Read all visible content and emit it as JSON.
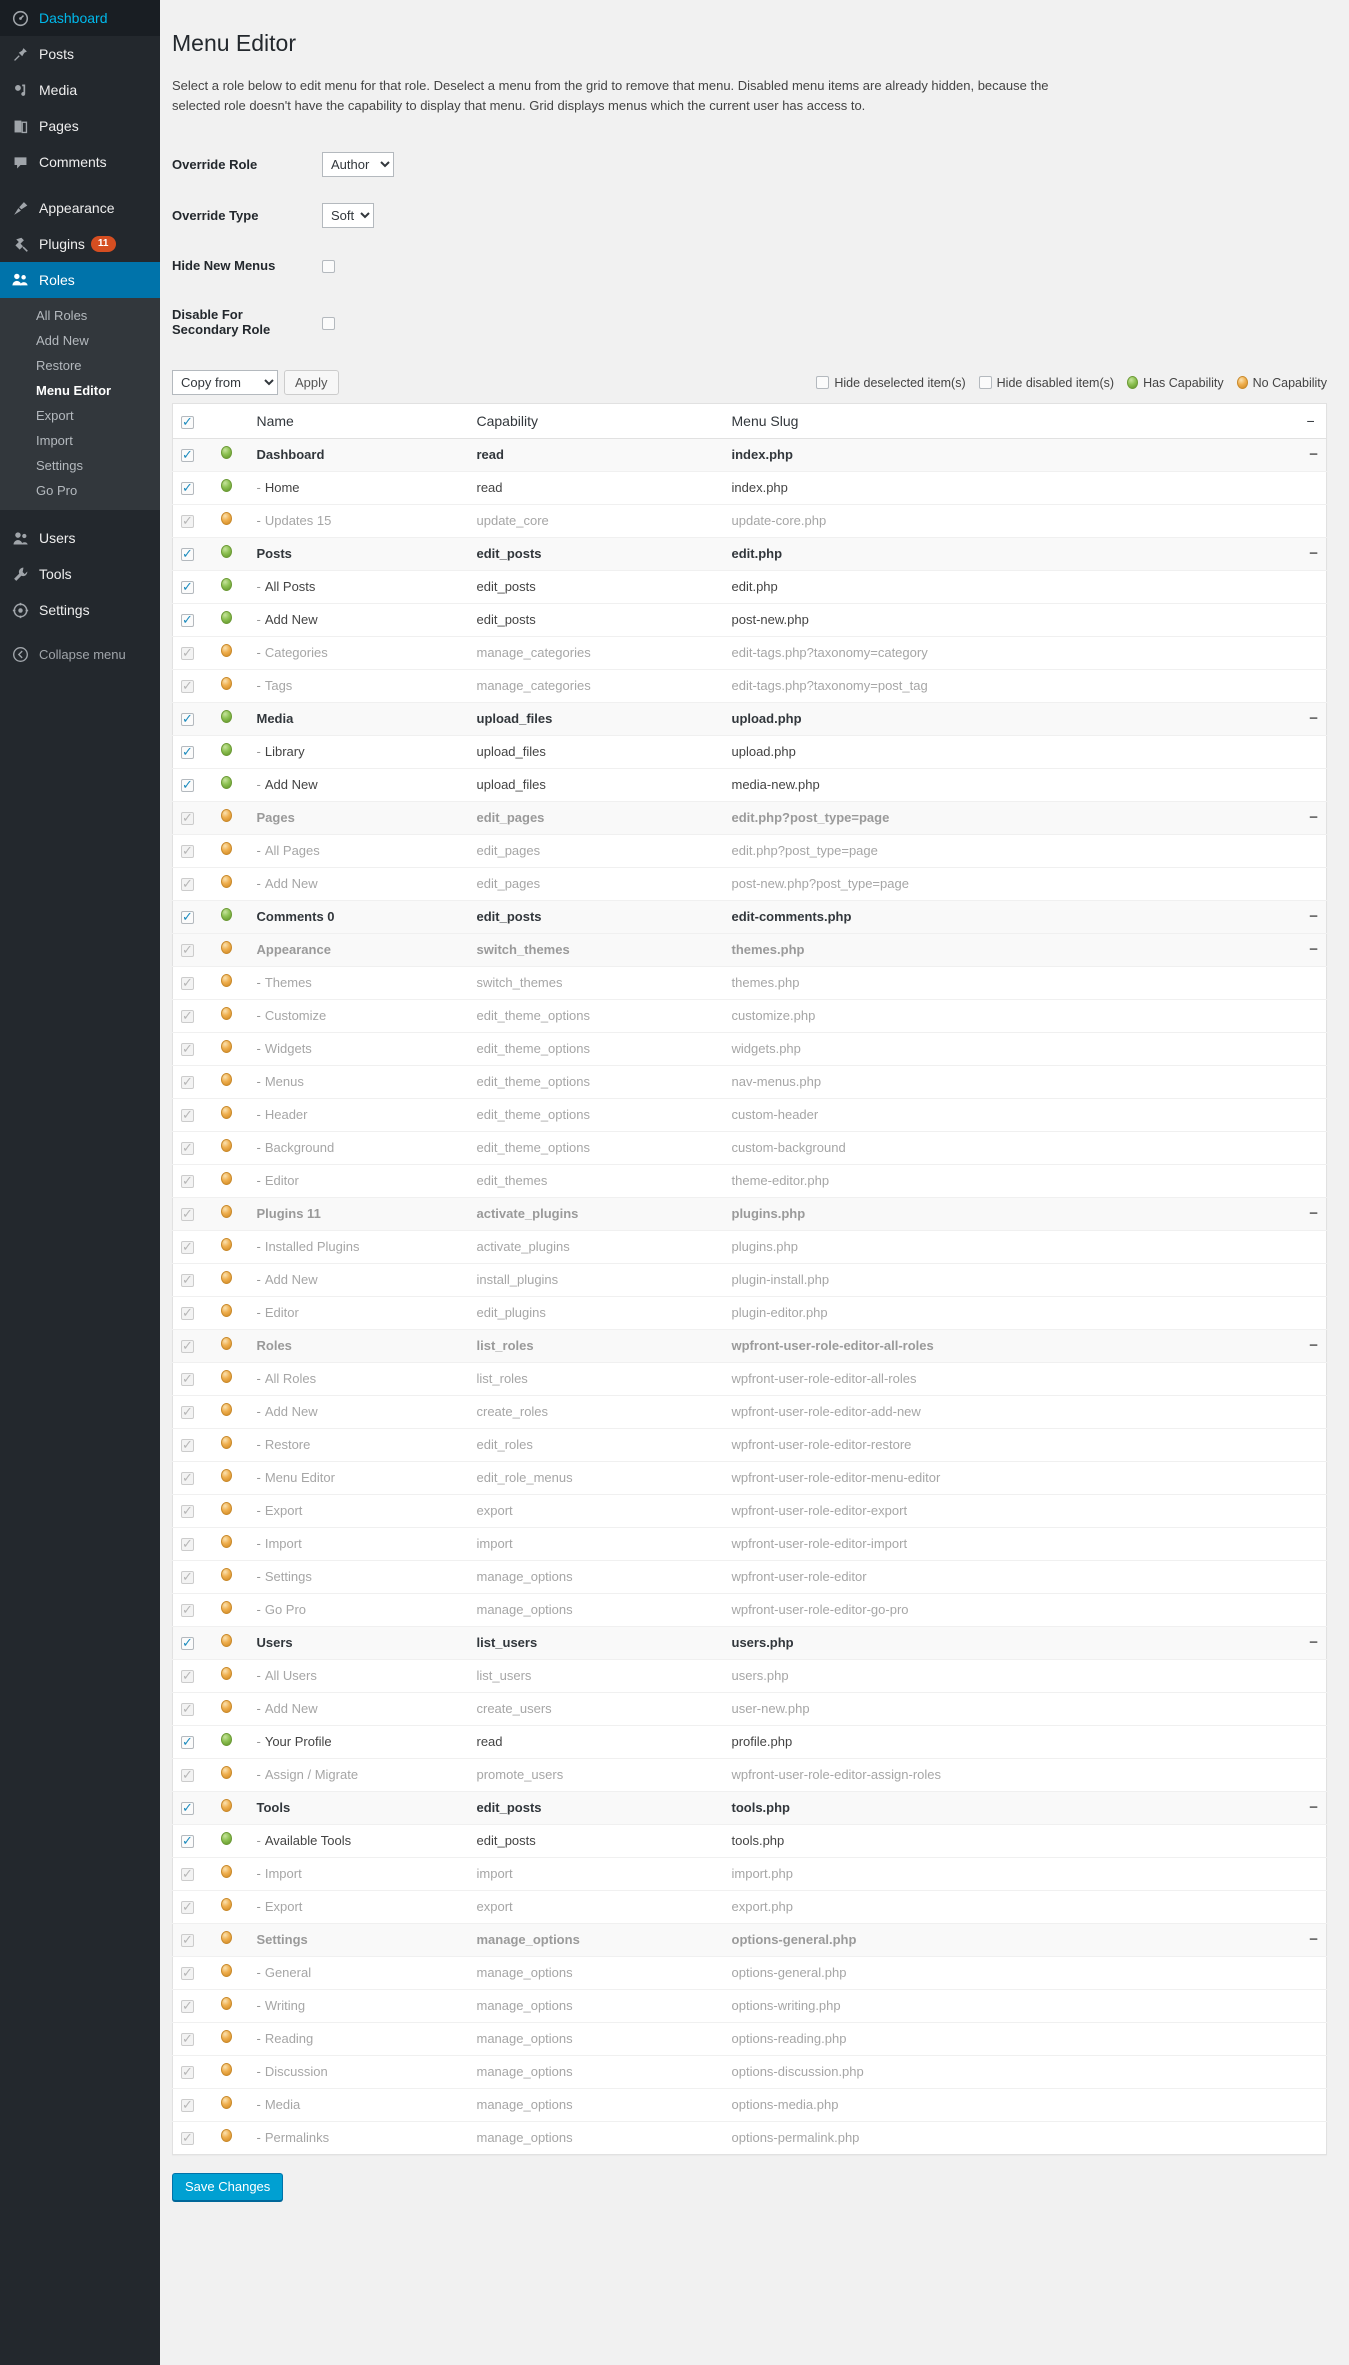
{
  "sidebar": {
    "top_items": [
      {
        "label": "Dashboard",
        "icon": "dashboard-icon",
        "current": false,
        "badge": null
      },
      {
        "label": "Posts",
        "icon": "pin-icon",
        "current": false,
        "badge": null
      },
      {
        "label": "Media",
        "icon": "media-icon",
        "current": false,
        "badge": null
      },
      {
        "label": "Pages",
        "icon": "pages-icon",
        "current": false,
        "badge": null
      },
      {
        "label": "Comments",
        "icon": "comments-icon",
        "current": false,
        "badge": null
      }
    ],
    "group2": [
      {
        "label": "Appearance",
        "icon": "appearance-icon",
        "current": false,
        "badge": null
      },
      {
        "label": "Plugins",
        "icon": "plugins-icon",
        "current": false,
        "badge": "11"
      },
      {
        "label": "Roles",
        "icon": "roles-icon",
        "current": true,
        "badge": null
      }
    ],
    "roles_submenu": [
      {
        "label": "All Roles",
        "current": false
      },
      {
        "label": "Add New",
        "current": false
      },
      {
        "label": "Restore",
        "current": false
      },
      {
        "label": "Menu Editor",
        "current": true
      },
      {
        "label": "Export",
        "current": false
      },
      {
        "label": "Import",
        "current": false
      },
      {
        "label": "Settings",
        "current": false
      },
      {
        "label": "Go Pro",
        "current": false
      }
    ],
    "group3": [
      {
        "label": "Users",
        "icon": "users-icon",
        "current": false,
        "badge": null
      },
      {
        "label": "Tools",
        "icon": "tools-icon",
        "current": false,
        "badge": null
      },
      {
        "label": "Settings",
        "icon": "settings-gear-icon",
        "current": false,
        "badge": null
      }
    ],
    "collapse": {
      "label": "Collapse menu",
      "icon": "collapse-arrow-icon"
    }
  },
  "page": {
    "title": "Menu Editor",
    "description": "Select a role below to edit menu for that role. Deselect a menu from the grid to remove that menu. Disabled menu items are already hidden, because the selected role doesn't have the capability to display that menu. Grid displays menus which the current user has access to."
  },
  "form": {
    "override_role": {
      "label": "Override Role",
      "value": "Author",
      "options": [
        "Author"
      ]
    },
    "override_type": {
      "label": "Override Type",
      "value": "Soft",
      "options": [
        "Soft"
      ]
    },
    "hide_new_menus": {
      "label": "Hide New Menus",
      "checked": false
    },
    "disable_secondary": {
      "label": "Disable For Secondary Role",
      "checked": false
    }
  },
  "toolbar": {
    "copy_from": {
      "value": "Copy from",
      "options": [
        "Copy from"
      ]
    },
    "apply_label": "Apply",
    "hide_deselected": {
      "label": "Hide deselected item(s)",
      "checked": false
    },
    "hide_disabled": {
      "label": "Hide disabled item(s)",
      "checked": false
    },
    "legend_has": "Has Capability",
    "legend_no": "No Capability"
  },
  "colors": {
    "accent": "#0073aa",
    "sidebar_bg": "#23282d",
    "submenu_bg": "#32373c",
    "badge": "#d54e21",
    "has_capability": "#8dc152",
    "no_capability": "#efaf4f",
    "primary_button": "#00a0d2"
  },
  "grid": {
    "headers": {
      "name": "Name",
      "capability": "Capability",
      "slug": "Menu Slug"
    },
    "header_checkbox": true,
    "collapse_glyph": "−",
    "rows": [
      {
        "level": "top",
        "checked": true,
        "disabled": false,
        "cap_dot": "green",
        "name": "Dashboard",
        "capability": "read",
        "slug": "index.php",
        "collapse": true
      },
      {
        "level": "sub",
        "checked": true,
        "disabled": false,
        "cap_dot": "green",
        "name": "Home",
        "capability": "read",
        "slug": "index.php",
        "collapse": false
      },
      {
        "level": "sub",
        "checked": true,
        "disabled": true,
        "cap_dot": "orange",
        "name": "Updates 15",
        "capability": "update_core",
        "slug": "update-core.php",
        "collapse": false
      },
      {
        "level": "top",
        "checked": true,
        "disabled": false,
        "cap_dot": "green",
        "name": "Posts",
        "capability": "edit_posts",
        "slug": "edit.php",
        "collapse": true
      },
      {
        "level": "sub",
        "checked": true,
        "disabled": false,
        "cap_dot": "green",
        "name": "All Posts",
        "capability": "edit_posts",
        "slug": "edit.php",
        "collapse": false
      },
      {
        "level": "sub",
        "checked": true,
        "disabled": false,
        "cap_dot": "green",
        "name": "Add New",
        "capability": "edit_posts",
        "slug": "post-new.php",
        "collapse": false
      },
      {
        "level": "sub",
        "checked": true,
        "disabled": true,
        "cap_dot": "orange",
        "name": "Categories",
        "capability": "manage_categories",
        "slug": "edit-tags.php?taxonomy=category",
        "collapse": false
      },
      {
        "level": "sub",
        "checked": true,
        "disabled": true,
        "cap_dot": "orange",
        "name": "Tags",
        "capability": "manage_categories",
        "slug": "edit-tags.php?taxonomy=post_tag",
        "collapse": false
      },
      {
        "level": "top",
        "checked": true,
        "disabled": false,
        "cap_dot": "green",
        "name": "Media",
        "capability": "upload_files",
        "slug": "upload.php",
        "collapse": true
      },
      {
        "level": "sub",
        "checked": true,
        "disabled": false,
        "cap_dot": "green",
        "name": "Library",
        "capability": "upload_files",
        "slug": "upload.php",
        "collapse": false
      },
      {
        "level": "sub",
        "checked": true,
        "disabled": false,
        "cap_dot": "green",
        "name": "Add New",
        "capability": "upload_files",
        "slug": "media-new.php",
        "collapse": false
      },
      {
        "level": "top",
        "checked": true,
        "disabled": true,
        "cap_dot": "orange",
        "name": "Pages",
        "capability": "edit_pages",
        "slug": "edit.php?post_type=page",
        "collapse": true
      },
      {
        "level": "sub",
        "checked": true,
        "disabled": true,
        "cap_dot": "orange",
        "name": "All Pages",
        "capability": "edit_pages",
        "slug": "edit.php?post_type=page",
        "collapse": false
      },
      {
        "level": "sub",
        "checked": true,
        "disabled": true,
        "cap_dot": "orange",
        "name": "Add New",
        "capability": "edit_pages",
        "slug": "post-new.php?post_type=page",
        "collapse": false
      },
      {
        "level": "top",
        "checked": true,
        "disabled": false,
        "cap_dot": "green",
        "name": "Comments 0",
        "capability": "edit_posts",
        "slug": "edit-comments.php",
        "collapse": true
      },
      {
        "level": "top",
        "checked": true,
        "disabled": true,
        "cap_dot": "orange",
        "name": "Appearance",
        "capability": "switch_themes",
        "slug": "themes.php",
        "collapse": true
      },
      {
        "level": "sub",
        "checked": true,
        "disabled": true,
        "cap_dot": "orange",
        "name": "Themes",
        "capability": "switch_themes",
        "slug": "themes.php",
        "collapse": false
      },
      {
        "level": "sub",
        "checked": true,
        "disabled": true,
        "cap_dot": "orange",
        "name": "Customize",
        "capability": "edit_theme_options",
        "slug": "customize.php",
        "collapse": false
      },
      {
        "level": "sub",
        "checked": true,
        "disabled": true,
        "cap_dot": "orange",
        "name": "Widgets",
        "capability": "edit_theme_options",
        "slug": "widgets.php",
        "collapse": false
      },
      {
        "level": "sub",
        "checked": true,
        "disabled": true,
        "cap_dot": "orange",
        "name": "Menus",
        "capability": "edit_theme_options",
        "slug": "nav-menus.php",
        "collapse": false
      },
      {
        "level": "sub",
        "checked": true,
        "disabled": true,
        "cap_dot": "orange",
        "name": "Header",
        "capability": "edit_theme_options",
        "slug": "custom-header",
        "collapse": false
      },
      {
        "level": "sub",
        "checked": true,
        "disabled": true,
        "cap_dot": "orange",
        "name": "Background",
        "capability": "edit_theme_options",
        "slug": "custom-background",
        "collapse": false
      },
      {
        "level": "sub",
        "checked": true,
        "disabled": true,
        "cap_dot": "orange",
        "name": "Editor",
        "capability": "edit_themes",
        "slug": "theme-editor.php",
        "collapse": false
      },
      {
        "level": "top",
        "checked": true,
        "disabled": true,
        "cap_dot": "orange",
        "name": "Plugins 11",
        "capability": "activate_plugins",
        "slug": "plugins.php",
        "collapse": true
      },
      {
        "level": "sub",
        "checked": true,
        "disabled": true,
        "cap_dot": "orange",
        "name": "Installed Plugins",
        "capability": "activate_plugins",
        "slug": "plugins.php",
        "collapse": false
      },
      {
        "level": "sub",
        "checked": true,
        "disabled": true,
        "cap_dot": "orange",
        "name": "Add New",
        "capability": "install_plugins",
        "slug": "plugin-install.php",
        "collapse": false
      },
      {
        "level": "sub",
        "checked": true,
        "disabled": true,
        "cap_dot": "orange",
        "name": "Editor",
        "capability": "edit_plugins",
        "slug": "plugin-editor.php",
        "collapse": false
      },
      {
        "level": "top",
        "checked": true,
        "disabled": true,
        "cap_dot": "orange",
        "name": "Roles",
        "capability": "list_roles",
        "slug": "wpfront-user-role-editor-all-roles",
        "collapse": true
      },
      {
        "level": "sub",
        "checked": true,
        "disabled": true,
        "cap_dot": "orange",
        "name": "All Roles",
        "capability": "list_roles",
        "slug": "wpfront-user-role-editor-all-roles",
        "collapse": false
      },
      {
        "level": "sub",
        "checked": true,
        "disabled": true,
        "cap_dot": "orange",
        "name": "Add New",
        "capability": "create_roles",
        "slug": "wpfront-user-role-editor-add-new",
        "collapse": false
      },
      {
        "level": "sub",
        "checked": true,
        "disabled": true,
        "cap_dot": "orange",
        "name": "Restore",
        "capability": "edit_roles",
        "slug": "wpfront-user-role-editor-restore",
        "collapse": false
      },
      {
        "level": "sub",
        "checked": true,
        "disabled": true,
        "cap_dot": "orange",
        "name": "Menu Editor",
        "capability": "edit_role_menus",
        "slug": "wpfront-user-role-editor-menu-editor",
        "collapse": false
      },
      {
        "level": "sub",
        "checked": true,
        "disabled": true,
        "cap_dot": "orange",
        "name": "Export",
        "capability": "export",
        "slug": "wpfront-user-role-editor-export",
        "collapse": false
      },
      {
        "level": "sub",
        "checked": true,
        "disabled": true,
        "cap_dot": "orange",
        "name": "Import",
        "capability": "import",
        "slug": "wpfront-user-role-editor-import",
        "collapse": false
      },
      {
        "level": "sub",
        "checked": true,
        "disabled": true,
        "cap_dot": "orange",
        "name": "Settings",
        "capability": "manage_options",
        "slug": "wpfront-user-role-editor",
        "collapse": false
      },
      {
        "level": "sub",
        "checked": true,
        "disabled": true,
        "cap_dot": "orange",
        "name": "Go Pro",
        "capability": "manage_options",
        "slug": "wpfront-user-role-editor-go-pro",
        "collapse": false
      },
      {
        "level": "top",
        "checked": true,
        "disabled": false,
        "cap_dot": "orange",
        "name": "Users",
        "capability": "list_users",
        "slug": "users.php",
        "collapse": true
      },
      {
        "level": "sub",
        "checked": true,
        "disabled": true,
        "cap_dot": "orange",
        "name": "All Users",
        "capability": "list_users",
        "slug": "users.php",
        "collapse": false
      },
      {
        "level": "sub",
        "checked": true,
        "disabled": true,
        "cap_dot": "orange",
        "name": "Add New",
        "capability": "create_users",
        "slug": "user-new.php",
        "collapse": false
      },
      {
        "level": "sub",
        "checked": true,
        "disabled": false,
        "cap_dot": "green",
        "name": "Your Profile",
        "capability": "read",
        "slug": "profile.php",
        "collapse": false
      },
      {
        "level": "sub",
        "checked": true,
        "disabled": true,
        "cap_dot": "orange",
        "name": "Assign / Migrate",
        "capability": "promote_users",
        "slug": "wpfront-user-role-editor-assign-roles",
        "collapse": false
      },
      {
        "level": "top",
        "checked": true,
        "disabled": false,
        "cap_dot": "orange",
        "name": "Tools",
        "capability": "edit_posts",
        "slug": "tools.php",
        "collapse": true
      },
      {
        "level": "sub",
        "checked": true,
        "disabled": false,
        "cap_dot": "green",
        "name": "Available Tools",
        "capability": "edit_posts",
        "slug": "tools.php",
        "collapse": false
      },
      {
        "level": "sub",
        "checked": true,
        "disabled": true,
        "cap_dot": "orange",
        "name": "Import",
        "capability": "import",
        "slug": "import.php",
        "collapse": false
      },
      {
        "level": "sub",
        "checked": true,
        "disabled": true,
        "cap_dot": "orange",
        "name": "Export",
        "capability": "export",
        "slug": "export.php",
        "collapse": false
      },
      {
        "level": "top",
        "checked": true,
        "disabled": true,
        "cap_dot": "orange",
        "name": "Settings",
        "capability": "manage_options",
        "slug": "options-general.php",
        "collapse": true
      },
      {
        "level": "sub",
        "checked": true,
        "disabled": true,
        "cap_dot": "orange",
        "name": "General",
        "capability": "manage_options",
        "slug": "options-general.php",
        "collapse": false
      },
      {
        "level": "sub",
        "checked": true,
        "disabled": true,
        "cap_dot": "orange",
        "name": "Writing",
        "capability": "manage_options",
        "slug": "options-writing.php",
        "collapse": false
      },
      {
        "level": "sub",
        "checked": true,
        "disabled": true,
        "cap_dot": "orange",
        "name": "Reading",
        "capability": "manage_options",
        "slug": "options-reading.php",
        "collapse": false
      },
      {
        "level": "sub",
        "checked": true,
        "disabled": true,
        "cap_dot": "orange",
        "name": "Discussion",
        "capability": "manage_options",
        "slug": "options-discussion.php",
        "collapse": false
      },
      {
        "level": "sub",
        "checked": true,
        "disabled": true,
        "cap_dot": "orange",
        "name": "Media",
        "capability": "manage_options",
        "slug": "options-media.php",
        "collapse": false
      },
      {
        "level": "sub",
        "checked": true,
        "disabled": true,
        "cap_dot": "orange",
        "name": "Permalinks",
        "capability": "manage_options",
        "slug": "options-permalink.php",
        "collapse": false
      }
    ]
  },
  "footer": {
    "save_label": "Save Changes"
  }
}
